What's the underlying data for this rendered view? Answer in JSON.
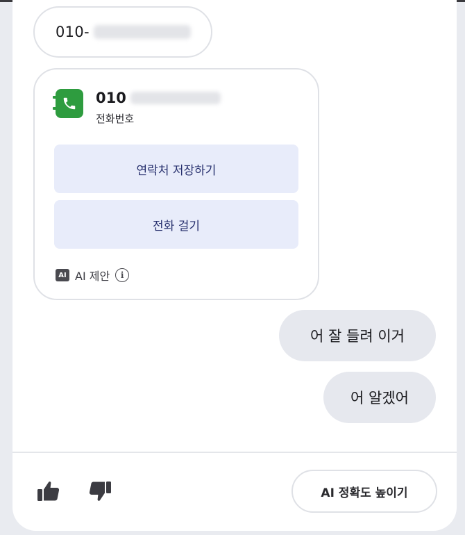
{
  "messages": {
    "incoming_phone_prefix": "010-",
    "outgoing": [
      "어 잘 들려 이거",
      "어 알겠어"
    ]
  },
  "contact_card": {
    "number_prefix": "010",
    "subtitle": "전화번호",
    "save_contact_label": "연락처 저장하기",
    "call_label": "전화 걸기",
    "ai_badge": "AI",
    "ai_suggestion_label": "AI 제안",
    "info_glyph": "i",
    "icon": "phone-book-icon",
    "icon_color": "#2e9c3f"
  },
  "footer": {
    "thumbs_up_icon": "thumbs-up-icon",
    "thumbs_down_icon": "thumbs-down-icon",
    "improve_accuracy_label": "AI 정확도 높이기"
  },
  "colors": {
    "button_bg": "#e8ecfa",
    "button_text": "#27306e",
    "outgoing_bubble": "#e6e8ee"
  }
}
